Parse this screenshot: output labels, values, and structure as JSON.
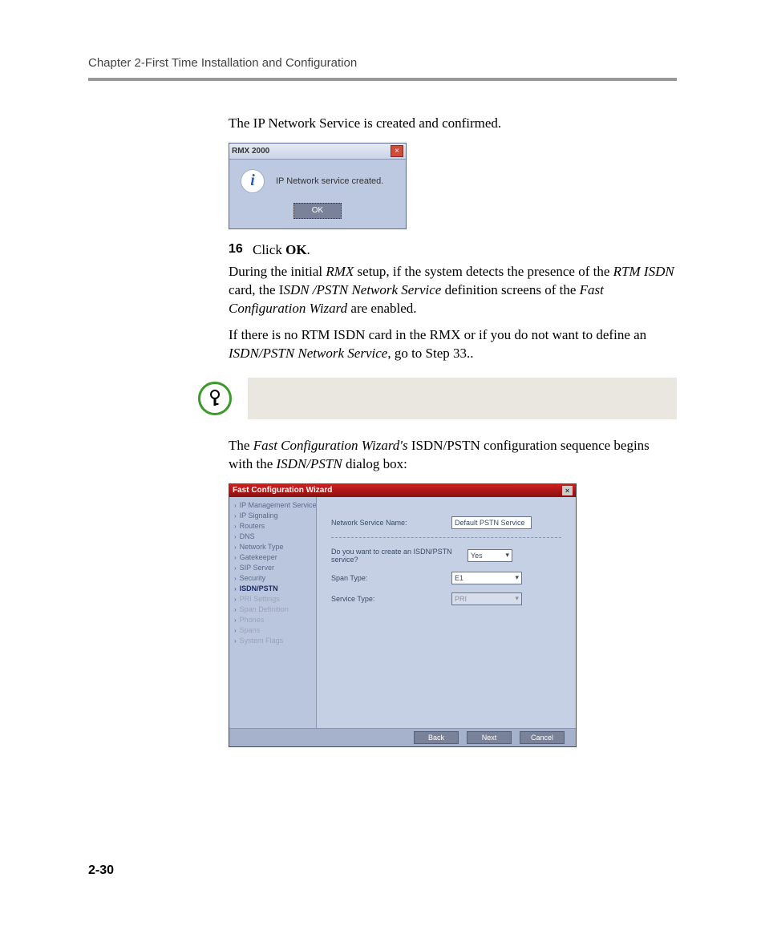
{
  "header": {
    "chapter": "Chapter 2-First Time Installation and Configuration"
  },
  "intro": {
    "p1": "The IP Network Service is created and confirmed."
  },
  "dlg1": {
    "title": "RMX 2000",
    "close": "×",
    "msg": "IP Network service created.",
    "ok": "OK"
  },
  "step16": {
    "num": "16",
    "prefix": "Click ",
    "bold": "OK",
    "suffix": "."
  },
  "p2": {
    "a": "During the initial ",
    "rmx": "RMX",
    "b": " setup, if the system detects the presence of the ",
    "rtm": "RTM ISDN",
    "c": " card, the I",
    "sdn": "SDN /PSTN Network Service",
    "d": " definition screens of the ",
    "fcw": "Fast Configuration Wizard",
    "e": " are enabled."
  },
  "p3": {
    "a": "If there is no RTM ISDN card in the RMX or if you do not want to define an ",
    "i": "ISDN/PSTN Network Service",
    "b": ", go to Step 33.."
  },
  "p4": {
    "a": "The ",
    "fcw": "Fast Configuration Wizard's",
    "b": " ISDN/PSTN configuration sequence begins with the ",
    "isdn": "ISDN/PSTN",
    "c": " dialog box:"
  },
  "wiz": {
    "title": "Fast Configuration Wizard",
    "close": "×",
    "side": {
      "i0": "IP Management Service",
      "i1": "IP Signaling",
      "i2": "Routers",
      "i3": "DNS",
      "i4": "Network Type",
      "i5": "Gatekeeper",
      "i6": "SIP Server",
      "i7": "Security",
      "i8": "ISDN/PSTN",
      "i9": "PRI Settings",
      "i10": "Span Definition",
      "i11": "Phones",
      "i12": "Spans",
      "i13": "System Flags"
    },
    "form": {
      "name_label": "Network Service Name:",
      "name_value": "Default PSTN Service",
      "q_label": "Do you want to create an ISDN/PSTN service?",
      "q_value": "Yes",
      "span_label": "Span Type:",
      "span_value": "E1",
      "svc_label": "Service Type:",
      "svc_value": "PRI"
    },
    "foot": {
      "back": "Back",
      "next": "Next",
      "cancel": "Cancel"
    }
  },
  "pagenum": "2-30"
}
